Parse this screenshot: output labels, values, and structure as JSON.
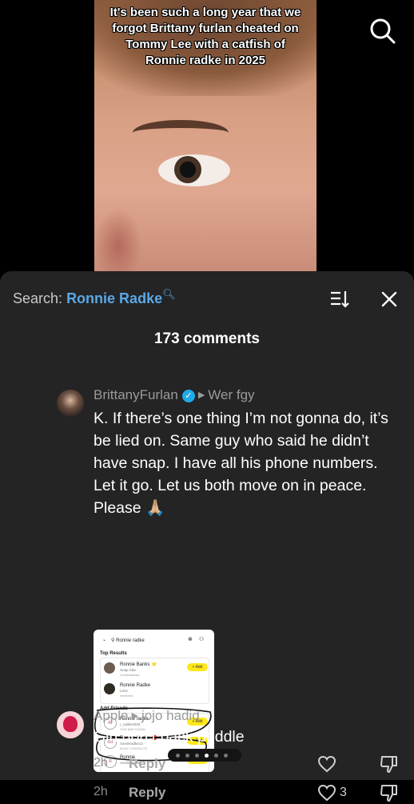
{
  "video": {
    "caption": "It's been such a long year that we\nforgot Brittany furlan cheated on\nTommy Lee with a catfish of\nRonnie radke in 2025",
    "search_icon": "search-icon"
  },
  "panel": {
    "search_label": "Search:",
    "search_query": "Ronnie Radke",
    "comments_count": "173 comments",
    "sort_icon": "sort-icon",
    "close_icon": "close-icon"
  },
  "comments": [
    {
      "username": "BrittanyFurlan",
      "verified": true,
      "reply_to": "Wer fgy",
      "text": "K. If there’s one thing I’m not gonna do, it’s be lied on. Same guy who said he didn’t have snap. I have all his phone numbers. Let it go. Let us both move on in peace. Please 🙏🏼",
      "time": "2h",
      "reply_label": "Reply",
      "likes": "3",
      "image": {
        "search_text": "Ronnie radke",
        "top_results_label": "Top Results",
        "results": [
          {
            "name": "Ronnie Banks ⭐",
            "sub": "Snap Star",
            "handle": "ronnieswanks",
            "button": "+ Add"
          },
          {
            "name": "Ronnie Radke",
            "sub": "Lens",
            "handle": "remixinnr",
            "button": ""
          }
        ],
        "add_friends_label": "Add Friends",
        "friends": [
          {
            "initials": "Rr",
            "name": "Ronnie radke",
            "handle": "r_radke2025",
            "note": "YOU MAY KNOW",
            "button": "+ Add"
          },
          {
            "initials": "RR",
            "name": "Ronnie Radke 🔴",
            "handle": "ronnieradke13",
            "note": "IN MY CONTACTS",
            "button": "+ Add"
          },
          {
            "initials": "R",
            "name": "Ronnie",
            "handle": "ronnie257487",
            "note": "",
            "button": "+ Add"
          }
        ]
      }
    },
    {
      "username": "Apple",
      "verified": false,
      "reply_to": "jojo hadid",
      "text": "Girl don’t back peddle",
      "time": "2h",
      "reply_label": "Reply",
      "likes": ""
    }
  ],
  "colors": {
    "sheet_bg": "#242424",
    "accent_blue": "#5aa8e8",
    "verified_blue": "#20a9e8",
    "snap_yellow": "#ffe71a"
  }
}
